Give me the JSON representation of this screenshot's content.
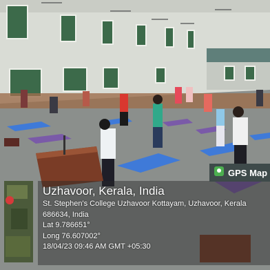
{
  "badge": {
    "label": "GPS Map",
    "icon": "map-pin-icon"
  },
  "location": {
    "city": "Uzhavoor, Kerala, India",
    "address": "St. Stephen's College Uzhavoor Kottayam, Uzhavoor, Kerala",
    "postal": "686634, India",
    "lat": "Lat 9.786651°",
    "long": "Long 76.607002°",
    "datetime": "18/04/23 09:46 AM GMT +05:30"
  },
  "colors": {
    "wall": "#d9dcd5",
    "floor": "#8b8f8c",
    "mat_blue": "#3f7ad8",
    "mat_purple": "#7a5aa8",
    "panel": "#2e2e2e"
  }
}
